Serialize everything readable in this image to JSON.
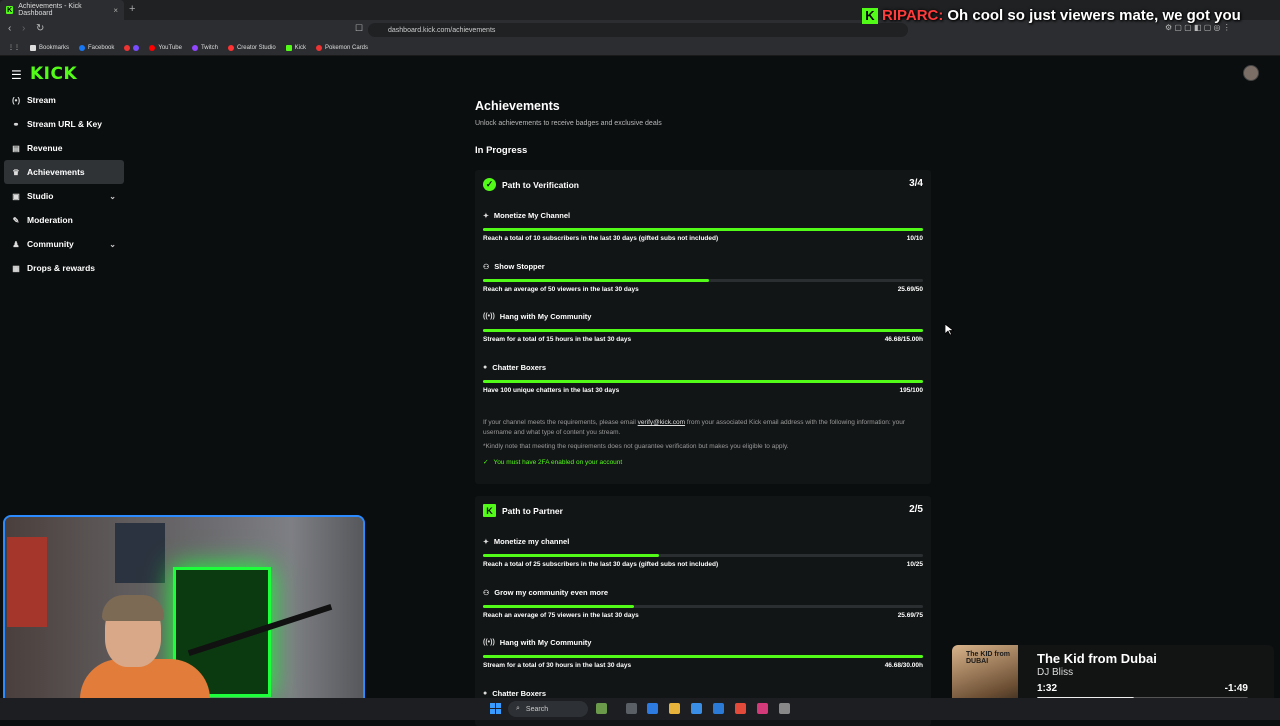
{
  "browser": {
    "tab_title": "Achievements - Kick Dashboard",
    "tab_close": "×",
    "new_tab": "+",
    "url": "dashboard.kick.com/achievements",
    "bookmarks": [
      "Bookmarks",
      "Facebook",
      "YouTube",
      "Twitch",
      "Creator Studio",
      "Kick",
      "Pokemon Cards"
    ]
  },
  "overlay": {
    "username": "RIPARC:",
    "message": "Oh cool so just viewers mate, we got you"
  },
  "header": {
    "logo": "KICK"
  },
  "sidebar": {
    "items": [
      {
        "label": "Stream",
        "icon": "(•)"
      },
      {
        "label": "Stream URL & Key",
        "icon": "⚭"
      },
      {
        "label": "Revenue",
        "icon": "▤"
      },
      {
        "label": "Achievements",
        "icon": "🏆"
      },
      {
        "label": "Studio",
        "icon": "▣"
      },
      {
        "label": "Moderation",
        "icon": "✎"
      },
      {
        "label": "Community",
        "icon": "♟"
      },
      {
        "label": "Drops & rewards",
        "icon": "▦"
      }
    ]
  },
  "main": {
    "title": "Achievements",
    "subtitle": "Unlock achievements to receive badges and exclusive deals",
    "section": "In Progress",
    "cards": [
      {
        "title": "Path to Verification",
        "count": "3/4",
        "requirements": [
          {
            "title": "Monetize My Channel",
            "icon": "✦",
            "desc": "Reach a total of 10 subscribers in the last 30 days (gifted subs not included)",
            "value": "10/10",
            "progress": 1.0
          },
          {
            "title": "Show Stopper",
            "icon": "⚇",
            "desc": "Reach an average of 50 viewers in the last 30 days",
            "value": "25.69/50",
            "progress": 0.514
          },
          {
            "title": "Hang with My Community",
            "icon": "((•))",
            "desc": "Stream for a total of 15 hours in the last 30 days",
            "value": "46.68/15.00h",
            "progress": 1.0
          },
          {
            "title": "Chatter Boxers",
            "icon": "●",
            "desc": "Have 100 unique chatters in the last 30 days",
            "value": "195/100",
            "progress": 1.0
          }
        ],
        "note_prefix": "If your channel meets the requirements, please email ",
        "note_email": "verify@kick.com",
        "note_suffix": " from your associated Kick email address with the following information: your username and what type of content you stream.",
        "note2": "*Kindly note that meeting the requirements does not guarantee verification but makes you eligible to apply.",
        "twofa": "You must have 2FA enabled on your account"
      },
      {
        "title": "Path to Partner",
        "count": "2/5",
        "requirements": [
          {
            "title": "Monetize my channel",
            "icon": "✦",
            "desc": "Reach a total of 25 subscribers in the last 30 days (gifted subs not included)",
            "value": "10/25",
            "progress": 0.4
          },
          {
            "title": "Grow my community even more",
            "icon": "⚇",
            "desc": "Reach an average of 75 viewers in the last 30 days",
            "value": "25.69/75",
            "progress": 0.343
          },
          {
            "title": "Hang with My Community",
            "icon": "((•))",
            "desc": "Stream for a total of 30 hours in the last 30 days",
            "value": "46.68/30.00h",
            "progress": 1.0
          },
          {
            "title": "Chatter Boxers",
            "icon": "●",
            "desc": "",
            "value": "",
            "progress": 0
          }
        ]
      }
    ]
  },
  "now_playing": {
    "art_label": "The KID from DUBAI",
    "title": "The Kid from Dubai",
    "artist": "DJ Bliss",
    "elapsed": "1:32",
    "remaining": "-1:49",
    "progress": 0.46
  },
  "taskbar": {
    "search": "Search"
  },
  "colors": {
    "kick_green": "#53fc18",
    "webcam_border": "#2c8cff",
    "overlay_user": "#ff3b3b"
  }
}
